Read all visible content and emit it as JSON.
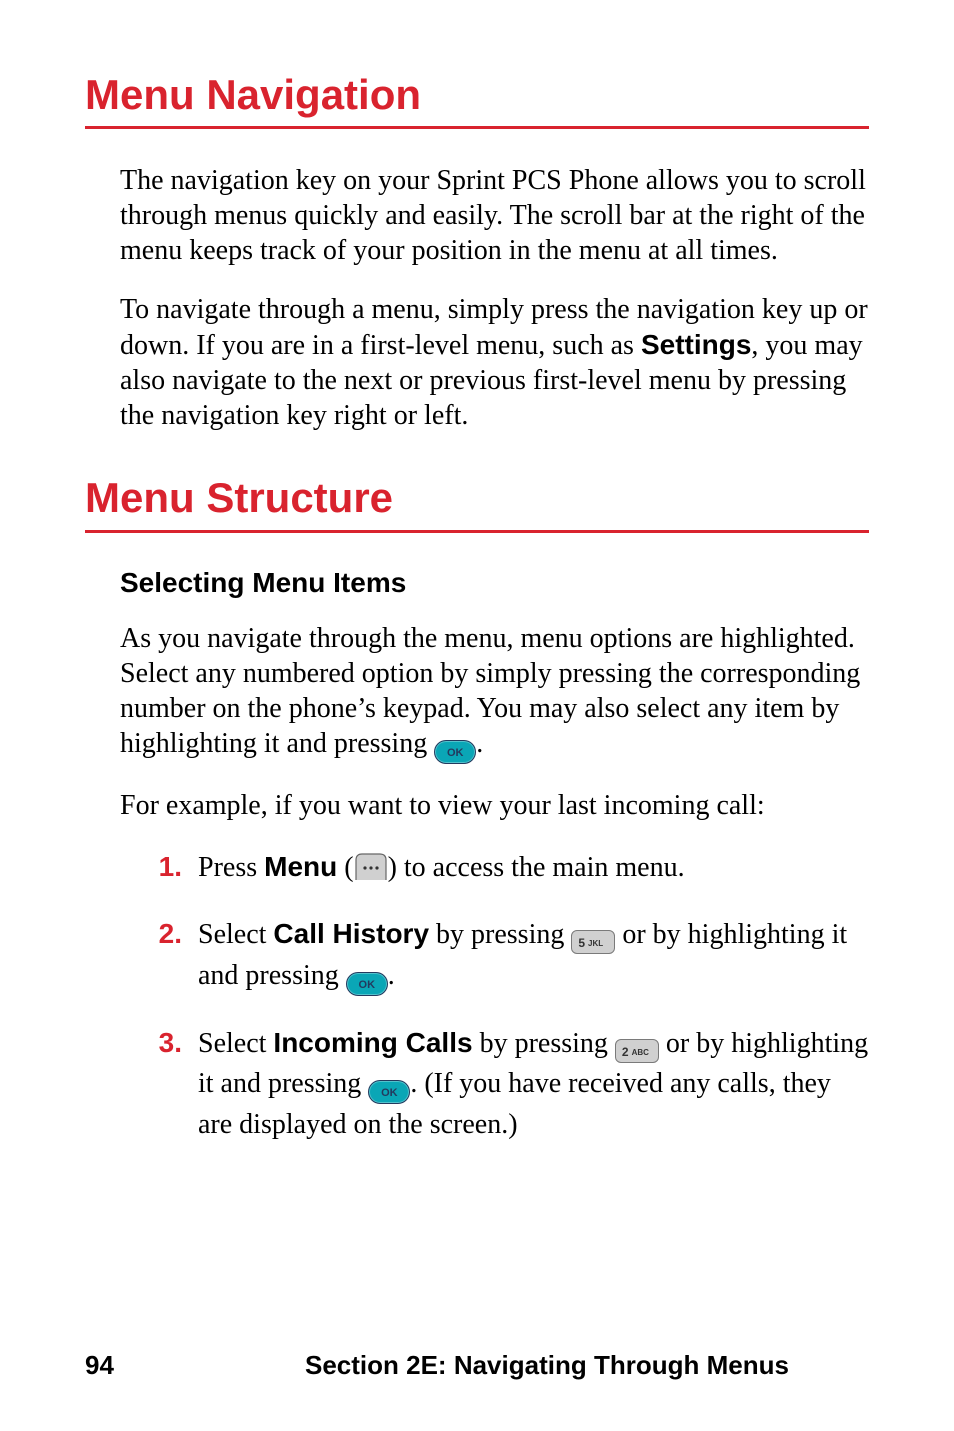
{
  "headings": {
    "nav": "Menu Navigation",
    "structure": "Menu Structure",
    "selecting": "Selecting Menu Items"
  },
  "para": {
    "nav1": "The navigation key on your Sprint PCS Phone allows you to scroll through menus quickly and easily. The scroll bar at the right of the menu keeps track of your position in the menu at all times.",
    "nav2_a": "To navigate through a menu, simply press the navigation key up or down. If you are in a first-level menu, such as ",
    "nav2_bold": "Settings",
    "nav2_b": ", you may also navigate to the next or previous first-level menu by pressing the navigation key right or left.",
    "sel1_a": "As you navigate through the menu, menu options are highlighted. Select any numbered option by simply pressing the corresponding number on the phone’s keypad. You may also select any item by highlighting it and pressing ",
    "sel1_b": ".",
    "sel2": "For example, if you want to view your last incoming call:"
  },
  "steps": [
    {
      "num": "1.",
      "a": "Press ",
      "bold1": "Menu",
      "b": " (",
      "c": ") to access the main menu."
    },
    {
      "num": "2.",
      "a": "Select ",
      "bold1": "Call History",
      "b": " by pressing ",
      "c": " or by highlighting it and pressing ",
      "d": "."
    },
    {
      "num": "3.",
      "a": "Select ",
      "bold1": "Incoming Calls",
      "b": " by pressing ",
      "c": " or by highlighting it and pressing ",
      "d": ". (If you have received any calls, they are displayed on the screen.)"
    }
  ],
  "keys": {
    "ok": "OK",
    "five": "5",
    "five_sub": "JKL",
    "two": "2",
    "two_sub": "ABC"
  },
  "footer": {
    "page": "94",
    "section": "Section 2E: Navigating Through Menus"
  }
}
